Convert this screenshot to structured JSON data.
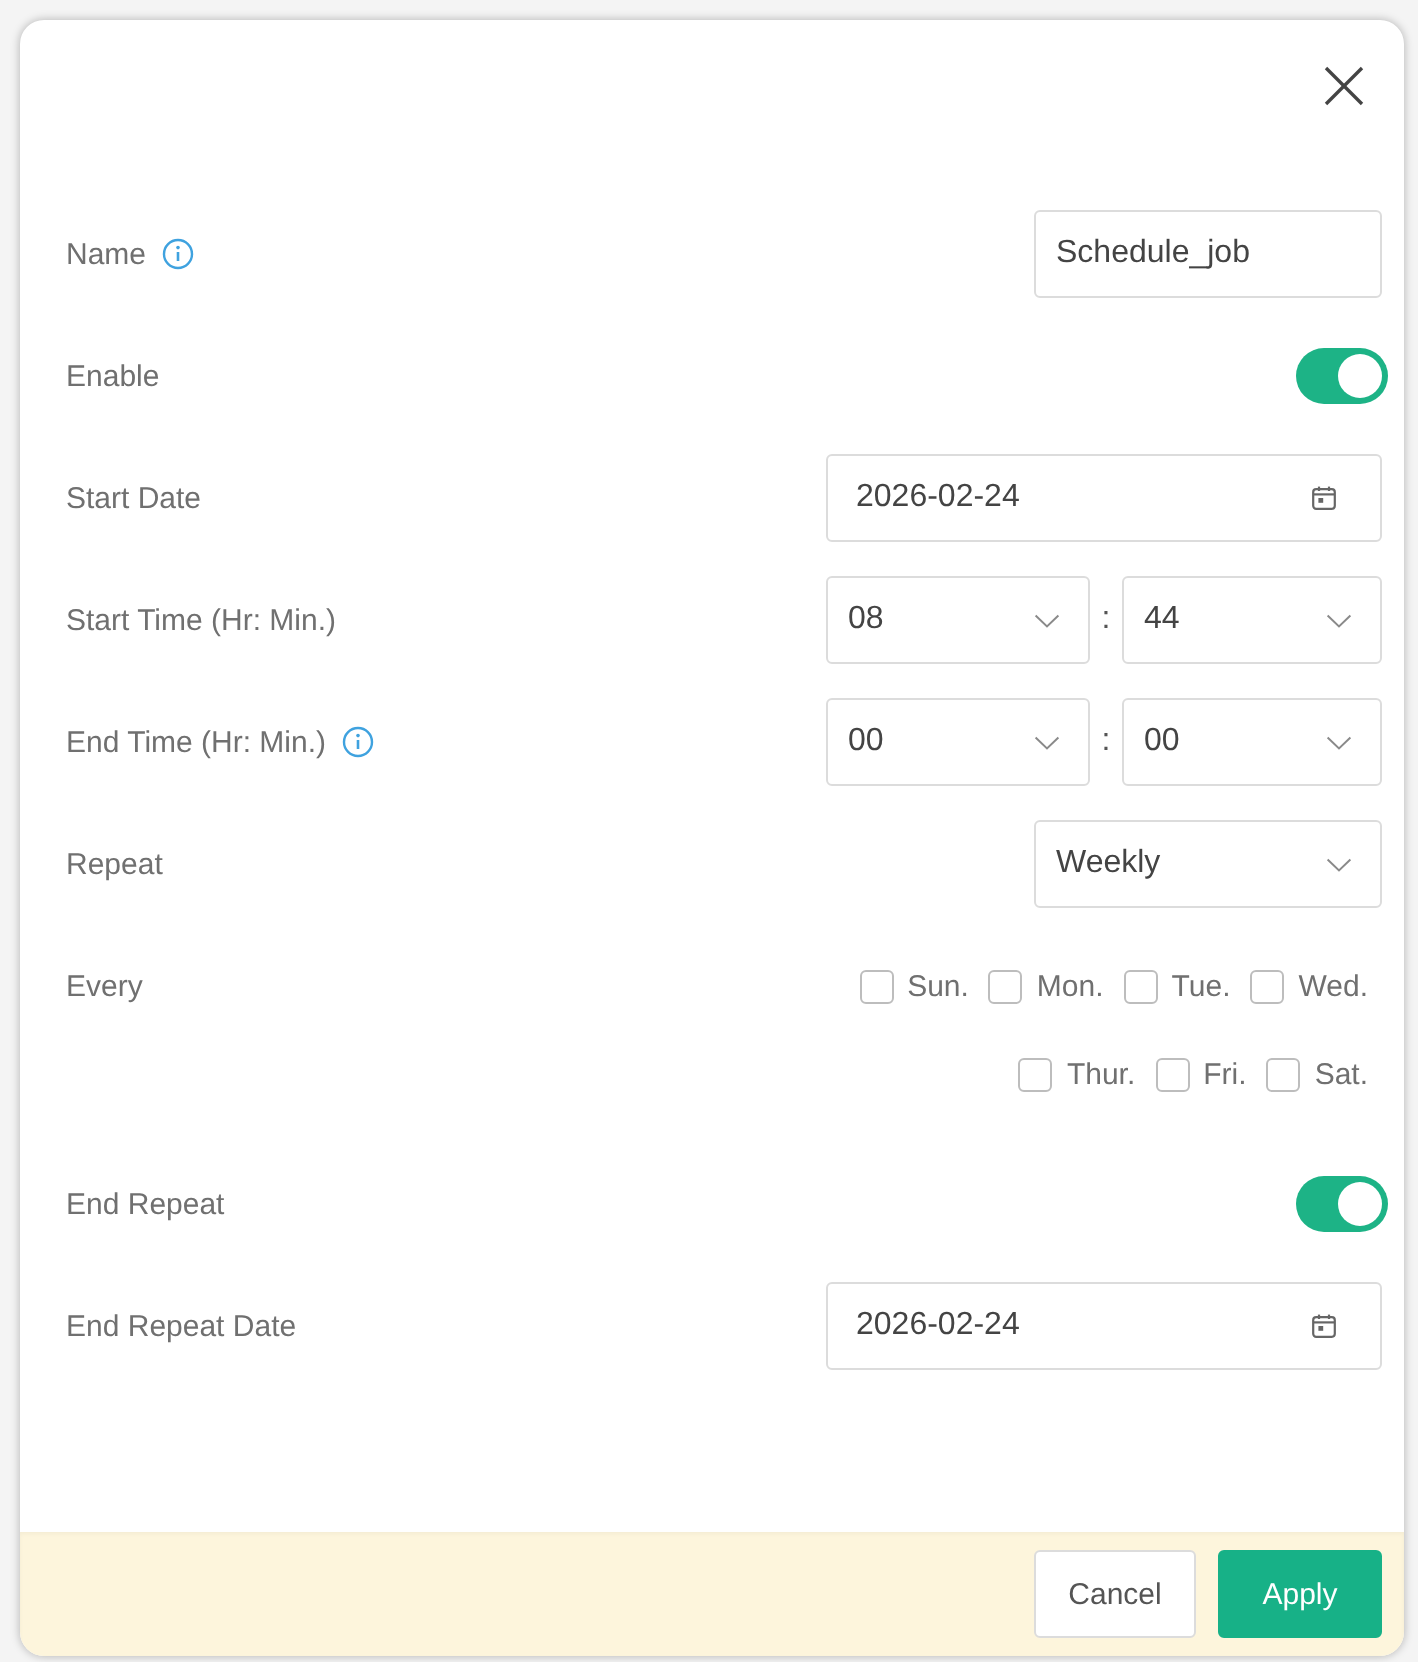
{
  "dialog": {
    "fields": [
      {
        "kind": "text",
        "label": "Name",
        "info": true,
        "value": "Schedule_job"
      },
      {
        "kind": "toggle",
        "label": "Enable",
        "info": false,
        "on": true
      },
      {
        "kind": "date",
        "label": "Start Date",
        "info": false,
        "value": "2026-02-24"
      },
      {
        "kind": "time",
        "label": "Start Time (Hr: Min.)",
        "info": false,
        "hour": "08",
        "separator": ":",
        "minute": "44"
      },
      {
        "kind": "time",
        "label": "End Time (Hr: Min.)",
        "info": true,
        "hour": "00",
        "separator": ":",
        "minute": "00"
      },
      {
        "kind": "select",
        "label": "Repeat",
        "info": false,
        "value": "Weekly"
      },
      {
        "kind": "weekdays",
        "label": "Every",
        "info": false,
        "days": [
          {
            "label": "Sun.",
            "checked": false
          },
          {
            "label": "Mon.",
            "checked": false
          },
          {
            "label": "Tue.",
            "checked": false
          },
          {
            "label": "Wed.",
            "checked": false
          },
          {
            "label": "Thur.",
            "checked": false
          },
          {
            "label": "Fri.",
            "checked": false
          },
          {
            "label": "Sat.",
            "checked": false
          }
        ]
      },
      {
        "kind": "toggle",
        "label": "End Repeat",
        "info": false,
        "on": true
      },
      {
        "kind": "date",
        "label": "End Repeat Date",
        "info": false,
        "value": "2026-02-24"
      }
    ],
    "buttons": [
      {
        "label": "Cancel",
        "kind": "secondary"
      },
      {
        "label": "Apply",
        "kind": "primary"
      }
    ]
  }
}
